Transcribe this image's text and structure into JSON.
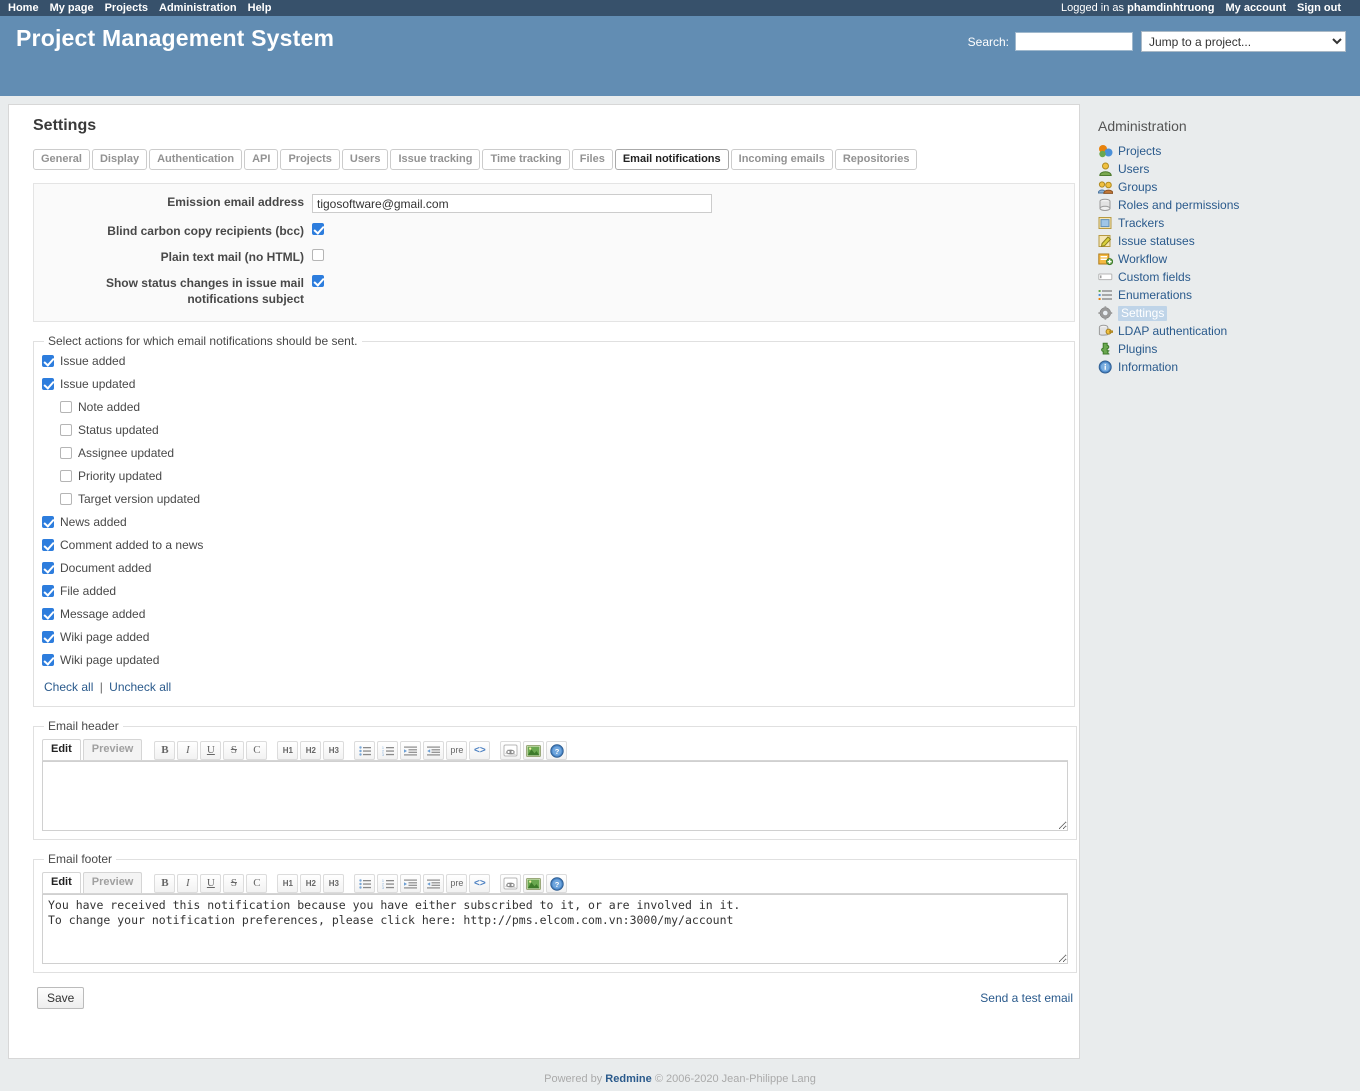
{
  "topnav": {
    "left_links": [
      "Home",
      "My page",
      "Projects",
      "Administration",
      "Help"
    ],
    "logged_in_prefix": "Logged in as",
    "username": "phamdinhtruong",
    "my_account": "My account",
    "sign_out": "Sign out"
  },
  "header": {
    "app_title": "Project Management System",
    "search_label": "Search:",
    "search_value": "",
    "project_jump_selected": "Jump to a project...",
    "bg_color": "#628db3",
    "topbar_color": "#37516b"
  },
  "page": {
    "title": "Settings"
  },
  "tabs": [
    {
      "label": "General",
      "selected": false
    },
    {
      "label": "Display",
      "selected": false
    },
    {
      "label": "Authentication",
      "selected": false
    },
    {
      "label": "API",
      "selected": false
    },
    {
      "label": "Projects",
      "selected": false
    },
    {
      "label": "Users",
      "selected": false
    },
    {
      "label": "Issue tracking",
      "selected": false
    },
    {
      "label": "Time tracking",
      "selected": false
    },
    {
      "label": "Files",
      "selected": false
    },
    {
      "label": "Email notifications",
      "selected": true
    },
    {
      "label": "Incoming emails",
      "selected": false
    },
    {
      "label": "Repositories",
      "selected": false
    }
  ],
  "settings_form": {
    "emission_email_label": "Emission email address",
    "emission_email_value": "tigosoftware@gmail.com",
    "bcc_label": "Blind carbon copy recipients (bcc)",
    "bcc_checked": true,
    "plain_text_label": "Plain text mail (no HTML)",
    "plain_text_checked": false,
    "show_status_label_line1": "Show status changes in issue mail",
    "show_status_label_line2": "notifications subject",
    "show_status_checked": true
  },
  "notified_events": {
    "legend": "Select actions for which email notifications should be sent.",
    "items": [
      {
        "label": "Issue added",
        "checked": true,
        "indent": false
      },
      {
        "label": "Issue updated",
        "checked": true,
        "indent": false
      },
      {
        "label": "Note added",
        "checked": false,
        "indent": true
      },
      {
        "label": "Status updated",
        "checked": false,
        "indent": true
      },
      {
        "label": "Assignee updated",
        "checked": false,
        "indent": true
      },
      {
        "label": "Priority updated",
        "checked": false,
        "indent": true
      },
      {
        "label": "Target version updated",
        "checked": false,
        "indent": true
      },
      {
        "label": "News added",
        "checked": true,
        "indent": false
      },
      {
        "label": "Comment added to a news",
        "checked": true,
        "indent": false
      },
      {
        "label": "Document added",
        "checked": true,
        "indent": false
      },
      {
        "label": "File added",
        "checked": true,
        "indent": false
      },
      {
        "label": "Message added",
        "checked": true,
        "indent": false
      },
      {
        "label": "Wiki page added",
        "checked": true,
        "indent": false
      },
      {
        "label": "Wiki page updated",
        "checked": true,
        "indent": false
      }
    ],
    "check_all": "Check all",
    "separator": "|",
    "uncheck_all": "Uncheck all"
  },
  "editor_toolbar": {
    "edit_tab": "Edit",
    "preview_tab": "Preview",
    "buttons": [
      {
        "name": "bold-icon",
        "glyph": "B",
        "style": "bold"
      },
      {
        "name": "italic-icon",
        "glyph": "I",
        "style": "italic"
      },
      {
        "name": "underline-icon",
        "glyph": "U",
        "style": "underline"
      },
      {
        "name": "strikethrough-icon",
        "glyph": "S",
        "style": "strike"
      },
      {
        "name": "code-inline-icon",
        "glyph": "C",
        "style": "plain"
      },
      {
        "name": "heading-1-icon",
        "glyph": "H1",
        "style": "small"
      },
      {
        "name": "heading-2-icon",
        "glyph": "H2",
        "style": "small"
      },
      {
        "name": "heading-3-icon",
        "glyph": "H3",
        "style": "small"
      },
      {
        "name": "unordered-list-icon",
        "glyph": "list-ul",
        "style": "svg"
      },
      {
        "name": "ordered-list-icon",
        "glyph": "list-ol",
        "style": "svg"
      },
      {
        "name": "indent-increase-icon",
        "glyph": "indent",
        "style": "svg"
      },
      {
        "name": "indent-decrease-icon",
        "glyph": "outdent",
        "style": "svg"
      },
      {
        "name": "preformatted-icon",
        "glyph": "pre",
        "style": "pre"
      },
      {
        "name": "code-block-icon",
        "glyph": "<>",
        "style": "codey"
      },
      {
        "name": "link-icon",
        "glyph": "link",
        "style": "svg"
      },
      {
        "name": "image-icon",
        "glyph": "image",
        "style": "svg"
      },
      {
        "name": "help-icon",
        "glyph": "help",
        "style": "svg"
      }
    ]
  },
  "email_header": {
    "legend": "Email header",
    "value": ""
  },
  "email_footer": {
    "legend": "Email footer",
    "value": "You have received this notification because you have either subscribed to it, or are involved in it.\nTo change your notification preferences, please click here: http://pms.elcom.com.vn:3000/my/account"
  },
  "actions": {
    "save_label": "Save",
    "send_test_email": "Send a test email"
  },
  "sidebar": {
    "title": "Administration",
    "items": [
      {
        "label": "Projects",
        "icon": "projects-icon",
        "selected": false
      },
      {
        "label": "Users",
        "icon": "users-icon",
        "selected": false
      },
      {
        "label": "Groups",
        "icon": "groups-icon",
        "selected": false
      },
      {
        "label": "Roles and permissions",
        "icon": "roles-icon",
        "selected": false
      },
      {
        "label": "Trackers",
        "icon": "trackers-icon",
        "selected": false
      },
      {
        "label": "Issue statuses",
        "icon": "issue-statuses-icon",
        "selected": false
      },
      {
        "label": "Workflow",
        "icon": "workflow-icon",
        "selected": false
      },
      {
        "label": "Custom fields",
        "icon": "custom-fields-icon",
        "selected": false
      },
      {
        "label": "Enumerations",
        "icon": "enumerations-icon",
        "selected": false
      },
      {
        "label": "Settings",
        "icon": "settings-gear-icon",
        "selected": true
      },
      {
        "label": "LDAP authentication",
        "icon": "ldap-icon",
        "selected": false
      },
      {
        "label": "Plugins",
        "icon": "plugins-icon",
        "selected": false
      },
      {
        "label": "Information",
        "icon": "information-icon",
        "selected": false
      }
    ]
  },
  "footer": {
    "powered_by": "Powered by",
    "product": "Redmine",
    "copyright": "© 2006-2020 Jean-Philippe Lang"
  }
}
